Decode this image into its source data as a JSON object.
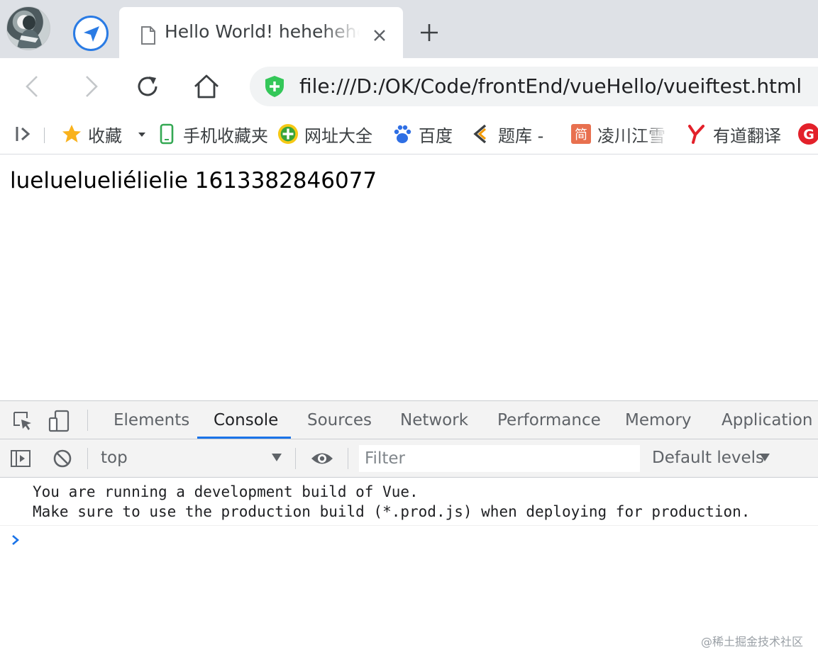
{
  "browser": {
    "tab": {
      "title": "Hello World! hehehehehehe",
      "close_icon": "close-icon"
    },
    "toolbar": {
      "url": "file:///D:/OK/Code/frontEnd/vueHello/vueiftest.html"
    },
    "bookmarks": [
      {
        "label": "收藏",
        "icon": "star-icon"
      },
      {
        "label": "手机收藏夹",
        "icon": "phone-icon"
      },
      {
        "label": "网址大全",
        "icon": "globe-plus-icon"
      },
      {
        "label": "百度",
        "icon": "baidu-paw-icon"
      },
      {
        "label": "题库 -",
        "icon": "tiku-icon"
      },
      {
        "label": "凌川江雪",
        "icon": "jian-icon"
      },
      {
        "label": "有道翻译",
        "icon": "youdao-icon"
      }
    ]
  },
  "page": {
    "content": "lueluelueliélielie 1613382846077"
  },
  "devtools": {
    "tabs": [
      "Elements",
      "Console",
      "Sources",
      "Network",
      "Performance",
      "Memory",
      "Application"
    ],
    "active_tab": "Console",
    "context": "top",
    "filter_placeholder": "Filter",
    "levels": "Default levels",
    "messages": [
      "You are running a development build of Vue.",
      "Make sure to use the production build (*.prod.js) when deploying for production."
    ]
  },
  "watermark": "@稀土掘金技术社区",
  "colors": {
    "accent": "#1a73e8",
    "secure": "#34c759",
    "tabstrip": "#dee1e6"
  }
}
